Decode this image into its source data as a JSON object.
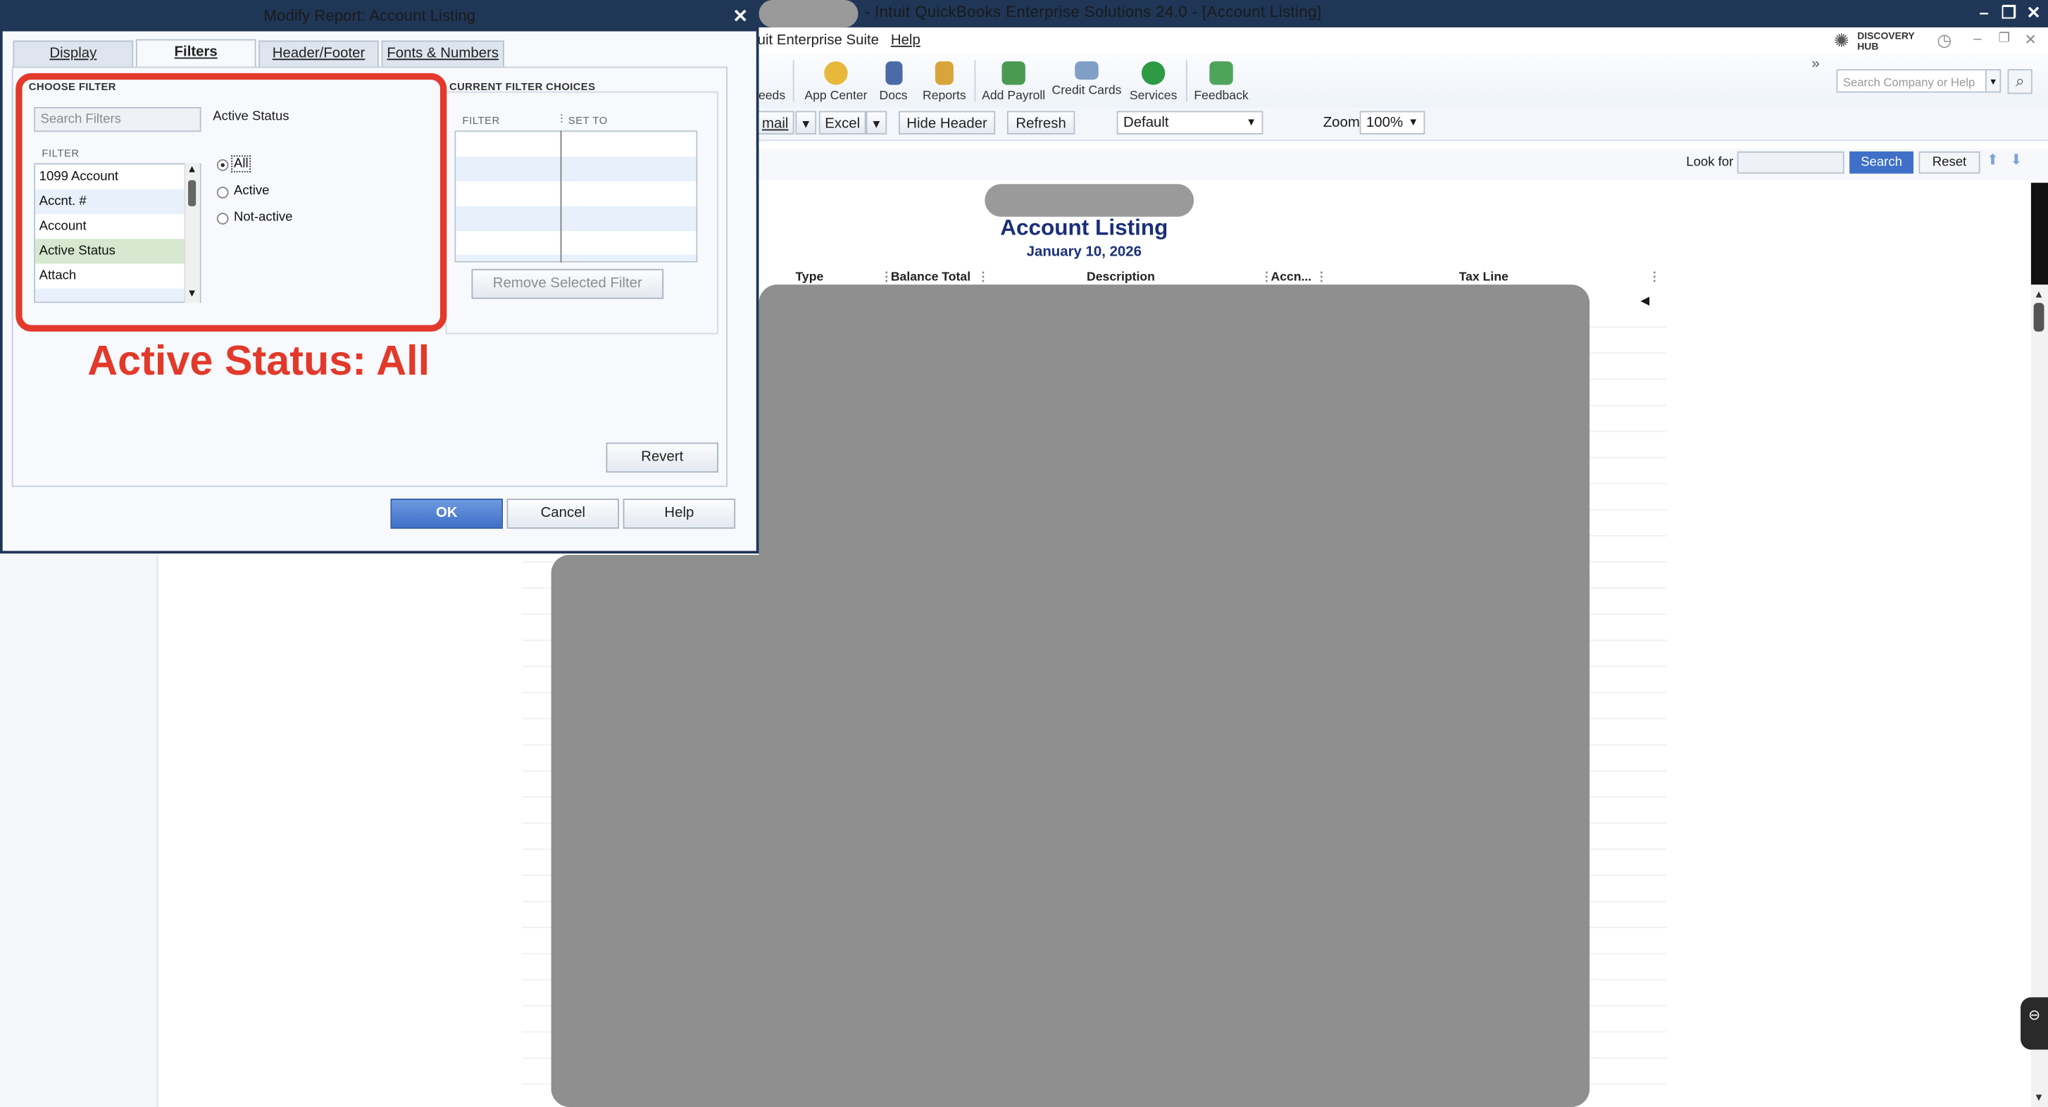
{
  "app": {
    "title_suffix": "- Intuit QuickBooks Enterprise Solutions 24.0 - [Account Listing]",
    "menu": [
      "uit Enterprise Suite",
      "Help"
    ],
    "discovery_hub": "DISCOVERY HUB",
    "search_placeholder": "Search Company or Help",
    "toolbar": [
      {
        "label": "eeds",
        "icon": "feeds-icon"
      },
      {
        "label": "App Center",
        "icon": "app-center-icon"
      },
      {
        "label": "Docs",
        "icon": "docs-icon"
      },
      {
        "label": "Reports",
        "icon": "reports-icon"
      },
      {
        "label": "Add Payroll",
        "icon": "payroll-icon"
      },
      {
        "label": "Credit Cards",
        "icon": "credit-card-icon"
      },
      {
        "label": "Services",
        "icon": "services-icon"
      },
      {
        "label": "Feedback",
        "icon": "feedback-icon"
      }
    ],
    "chevrons": "»"
  },
  "report_toolbar": {
    "email": "mail",
    "excel": "Excel",
    "hide_header": "Hide Header",
    "refresh": "Refresh",
    "view": "Default",
    "zoom_label": "Zoom",
    "zoom_value": "100%"
  },
  "lookfor": {
    "label": "Look for",
    "search": "Search",
    "reset": "Reset"
  },
  "report": {
    "title": "Account Listing",
    "date": "January 10, 2026",
    "columns": [
      "Type",
      "Balance Total",
      "Description",
      "Accn...",
      "Tax Line"
    ]
  },
  "dialog": {
    "title": "Modify Report: Account Listing",
    "tabs": [
      "Display",
      "Filters",
      "Header/Footer",
      "Fonts & Numbers"
    ],
    "active_tab": "Filters",
    "choose_filter": "CHOOSE FILTER",
    "search_placeholder": "Search Filters",
    "filter_col": "FILTER",
    "filters": [
      "1099 Account",
      "Accnt. #",
      "Account",
      "Active Status",
      "Attach"
    ],
    "selected_filter": "Active Status",
    "filter_detail_title": "Active Status",
    "radio_options": [
      "All",
      "Active",
      "Not-active"
    ],
    "radio_selected": "All",
    "current_choices": "CURRENT FILTER CHOICES",
    "cfc_filter_col": "FILTER",
    "cfc_setto_col": "SET TO",
    "remove_btn": "Remove Selected Filter",
    "revert_btn": "Revert",
    "ok_btn": "OK",
    "cancel_btn": "Cancel",
    "help_btn": "Help"
  },
  "annotation": {
    "text": "Active Status: All",
    "color": "#e2392b"
  }
}
